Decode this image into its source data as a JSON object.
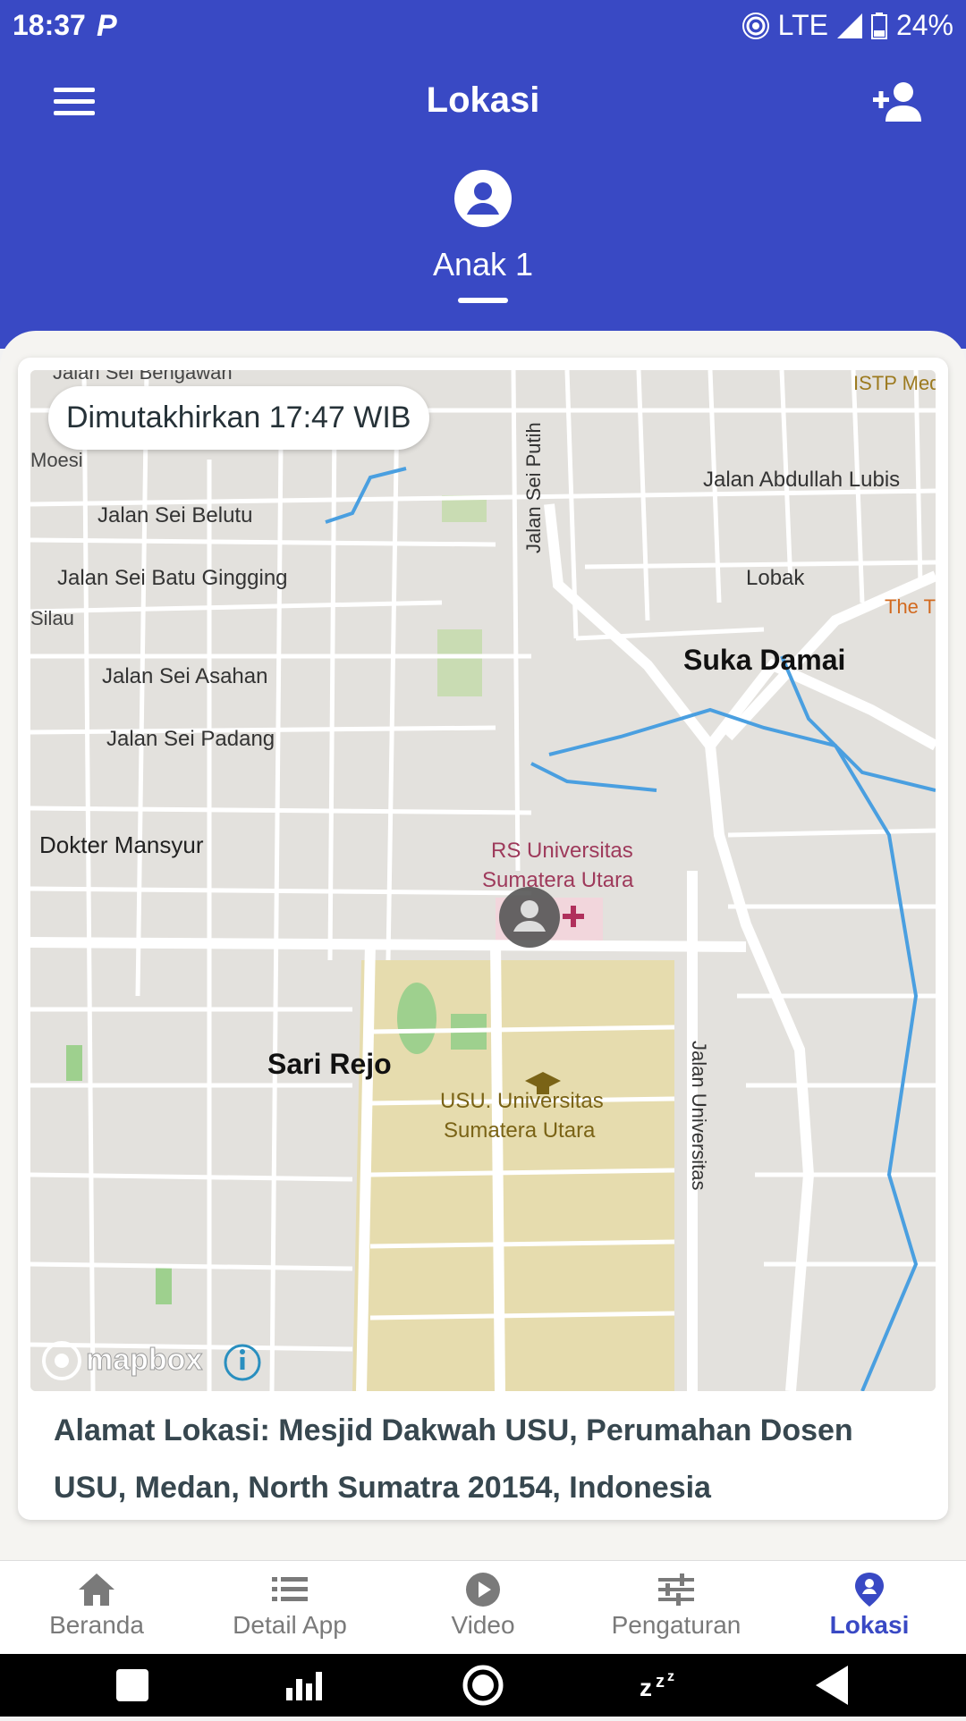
{
  "status_bar": {
    "time": "18:37",
    "network": "LTE",
    "battery": "24%"
  },
  "app_bar": {
    "title": "Lokasi"
  },
  "child_tab": {
    "name": "Anak 1"
  },
  "map": {
    "updated_label": "Dimutakhirkan 17:47 WIB",
    "labels": {
      "l1": "Jalan Sei Bengawan",
      "l2": "ISTP Med",
      "l3": "Moesi",
      "l4": "Jalan Abdullah Lubis",
      "l5": "Jalan Sei Belutu",
      "l6": "Jalan Sei Batu Gingging",
      "l7": "Lobak",
      "l8": "Silau",
      "l9": "The T",
      "l10": "Suka Damai",
      "l11": "Jalan Sei Asahan",
      "l12": "Jalan Sei Padang",
      "l13": "Dokter Mansyur",
      "l14": "RS Universitas",
      "l15": "Sumatera Utara",
      "l16": "Sari Rejo",
      "l17": "USU. Universitas",
      "l18": "Sumatera Utara",
      "l19": "Jalan Sei Putih",
      "l20": "Jalan Universitas",
      "brand": "mapbox"
    }
  },
  "address": "Alamat Lokasi: Mesjid Dakwah USU, Perumahan Dosen USU, Medan, North Sumatra 20154, Indonesia",
  "bottom_nav": [
    {
      "label": "Beranda",
      "icon": "home-icon"
    },
    {
      "label": "Detail App",
      "icon": "list-icon"
    },
    {
      "label": "Video",
      "icon": "play-icon"
    },
    {
      "label": "Pengaturan",
      "icon": "sliders-icon"
    },
    {
      "label": "Lokasi",
      "icon": "location-person-icon",
      "active": true
    }
  ],
  "colors": {
    "primary": "#3949c4",
    "campus": "#e6dcae",
    "water": "#4a9fe0"
  }
}
